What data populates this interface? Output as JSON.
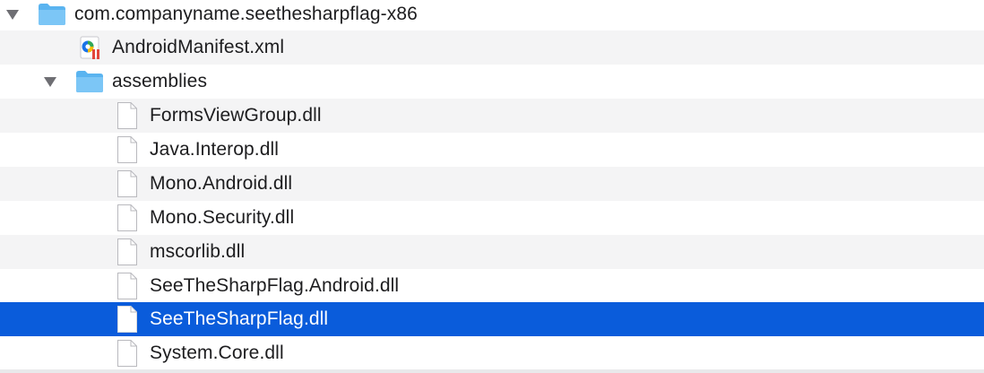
{
  "tree": {
    "root": {
      "label": "com.companyname.seethesharpflag-x86",
      "icon": "folder-icon",
      "expanded": true
    },
    "manifest": {
      "label": "AndroidManifest.xml",
      "icon": "xml-file-icon"
    },
    "assemblies": {
      "label": "assemblies",
      "icon": "folder-icon",
      "expanded": true
    },
    "files": [
      {
        "label": "FormsViewGroup.dll",
        "icon": "document-icon",
        "selected": false
      },
      {
        "label": "Java.Interop.dll",
        "icon": "document-icon",
        "selected": false
      },
      {
        "label": "Mono.Android.dll",
        "icon": "document-icon",
        "selected": false
      },
      {
        "label": "Mono.Security.dll",
        "icon": "document-icon",
        "selected": false
      },
      {
        "label": "mscorlib.dll",
        "icon": "document-icon",
        "selected": false
      },
      {
        "label": "SeeTheSharpFlag.Android.dll",
        "icon": "document-icon",
        "selected": false
      },
      {
        "label": "SeeTheSharpFlag.dll",
        "icon": "document-icon",
        "selected": true
      },
      {
        "label": "System.Core.dll",
        "icon": "document-icon",
        "selected": false
      }
    ]
  },
  "colors": {
    "selection": "#0a5cdb",
    "stripe": "#f4f4f5",
    "folder": "#5ab4f0",
    "text": "#1d1d1f"
  }
}
